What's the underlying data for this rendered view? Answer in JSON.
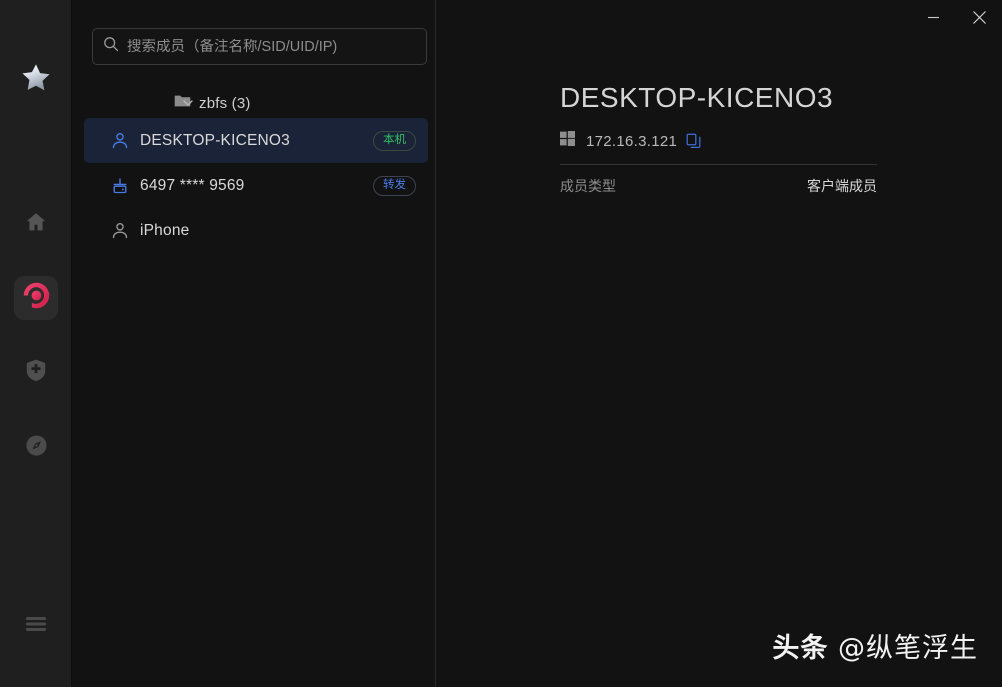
{
  "window": {
    "minimize_label": "—",
    "close_label": "×"
  },
  "rail": {
    "items": [
      {
        "id": "favorites",
        "icon": "star-icon",
        "selected": false
      },
      {
        "id": "home",
        "icon": "home-icon",
        "selected": false
      },
      {
        "id": "network",
        "icon": "app-logo-icon",
        "selected": true
      },
      {
        "id": "security",
        "icon": "shield-plus-icon",
        "selected": false
      },
      {
        "id": "discover",
        "icon": "compass-icon",
        "selected": false
      },
      {
        "id": "menu",
        "icon": "hamburger-menu-icon",
        "selected": false
      }
    ]
  },
  "search": {
    "value": "",
    "placeholder": "搜索成员（备注名称/SID/UID/IP)",
    "icon": "search-icon"
  },
  "tree": {
    "folder": {
      "label": "zbfs (3)",
      "expanded": true,
      "chevron_icon": "chevron-down-icon",
      "folder_icon": "folder-icon"
    },
    "members": [
      {
        "name": "DESKTOP-KICENO3",
        "icon": "person-icon",
        "icon_color": "#4a7ce8",
        "selected": true,
        "badge": {
          "text": "本机",
          "style": "green"
        }
      },
      {
        "name": "6497 **** 9569",
        "icon": "router-device-icon",
        "icon_color": "#4a7ce8",
        "selected": false,
        "badge": {
          "text": "转发",
          "style": "blue"
        }
      },
      {
        "name": "iPhone",
        "icon": "person-icon",
        "icon_color": "#9a9a9a",
        "selected": false,
        "badge": null
      }
    ]
  },
  "detail": {
    "title": "DESKTOP-KICENO3",
    "os_icon": "windows-logo-icon",
    "ip": "172.16.3.121",
    "copy_icon": "copy-icon",
    "info_rows": [
      {
        "key": "成员类型",
        "value": "客户端成员"
      }
    ]
  },
  "watermark": {
    "brand": "头条",
    "handle": "@纵笔浮生"
  },
  "colors": {
    "accent_blue": "#4a7ce8",
    "badge_green": "#2fbf63",
    "selected_row_bg": "#1b2338",
    "rail_bg": "#1f1f1f",
    "panel_bg": "#121212",
    "app_logo_pink": "#e83a5f"
  }
}
